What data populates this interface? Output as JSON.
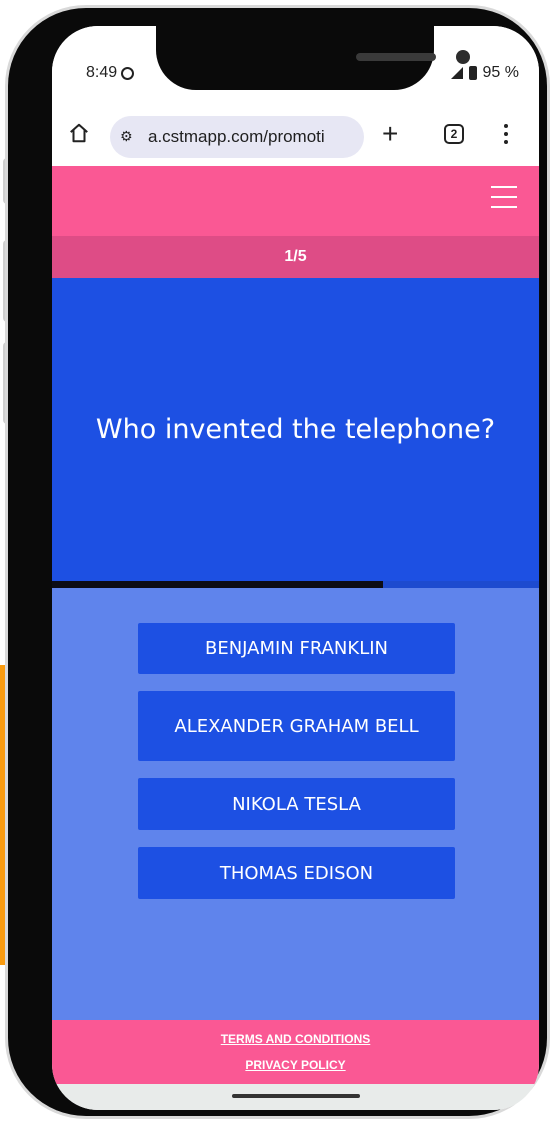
{
  "status_bar": {
    "time": "8:49",
    "battery": "95 %"
  },
  "browser": {
    "url": "a.cstmapp.com/promoti",
    "tab_count": "2"
  },
  "quiz": {
    "progress": "1/5",
    "question": "Who invented the telephone?",
    "timer_remaining_fraction": 0.68,
    "answers": [
      "BENJAMIN FRANKLIN",
      "ALEXANDER GRAHAM BELL",
      "NIKOLA TESLA",
      "THOMAS EDISON"
    ]
  },
  "footer": {
    "terms": "TERMS AND CONDITIONS",
    "privacy": "PRIVACY POLICY"
  },
  "colors": {
    "header_pink": "#fa5894",
    "question_blue": "#1d50e3",
    "answers_bg": "#5f84ec",
    "accent_orange": "#f99b10"
  }
}
